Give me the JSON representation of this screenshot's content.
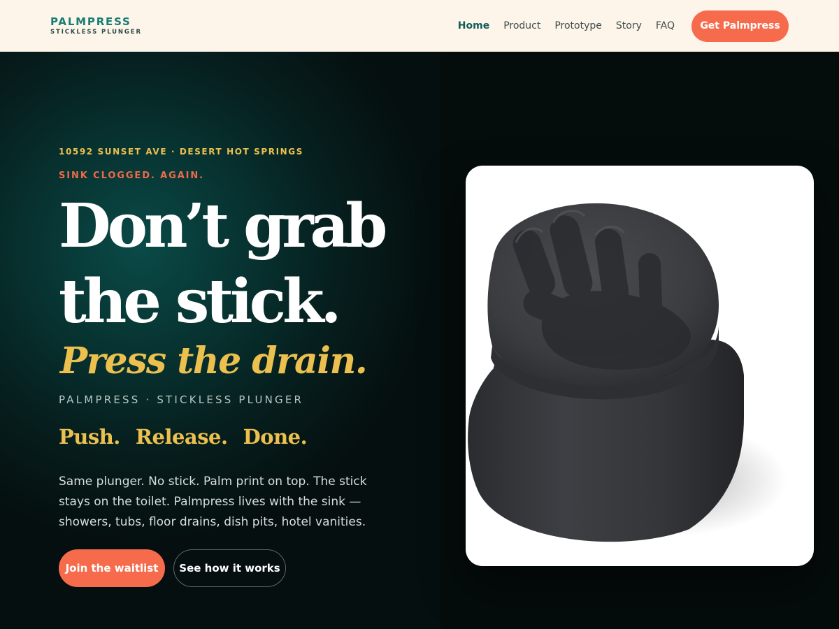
{
  "header": {
    "brand_name": "PALMPRESS",
    "brand_sub": "STICKLESS PLUNGER",
    "nav": [
      "Home",
      "Product",
      "Prototype",
      "Story",
      "FAQ"
    ],
    "active_nav": "Home",
    "cta_label": "Get Palmpress"
  },
  "hero": {
    "eyebrow": "10592 SUNSET AVE · DESERT HOT SPRINGS",
    "kicker": "SINK CLOGGED. AGAIN.",
    "headline_line1": "Don’t grab",
    "headline_line2": "the stick.",
    "subhead": "Press the drain.",
    "tagline": "PALMPRESS · STICKLESS PLUNGER",
    "steps": [
      "Push.",
      "Release.",
      "Done."
    ],
    "body": "Same plunger. No stick. Palm print on top. The stick stays on the toilet. Palmpress lives with the sink — showers, tubs, floor drains, dish pits, hotel vanities.",
    "primary_button": "Join the waitlist",
    "secondary_button": "See how it works"
  },
  "product_image": {
    "icon": "palm-plunger-product-image"
  },
  "colors": {
    "accent": "#f76b4d",
    "gold": "#ecc04f",
    "teal": "#167d75",
    "header_bg": "#fdf5ea",
    "hero_bg": "#060d0d"
  }
}
